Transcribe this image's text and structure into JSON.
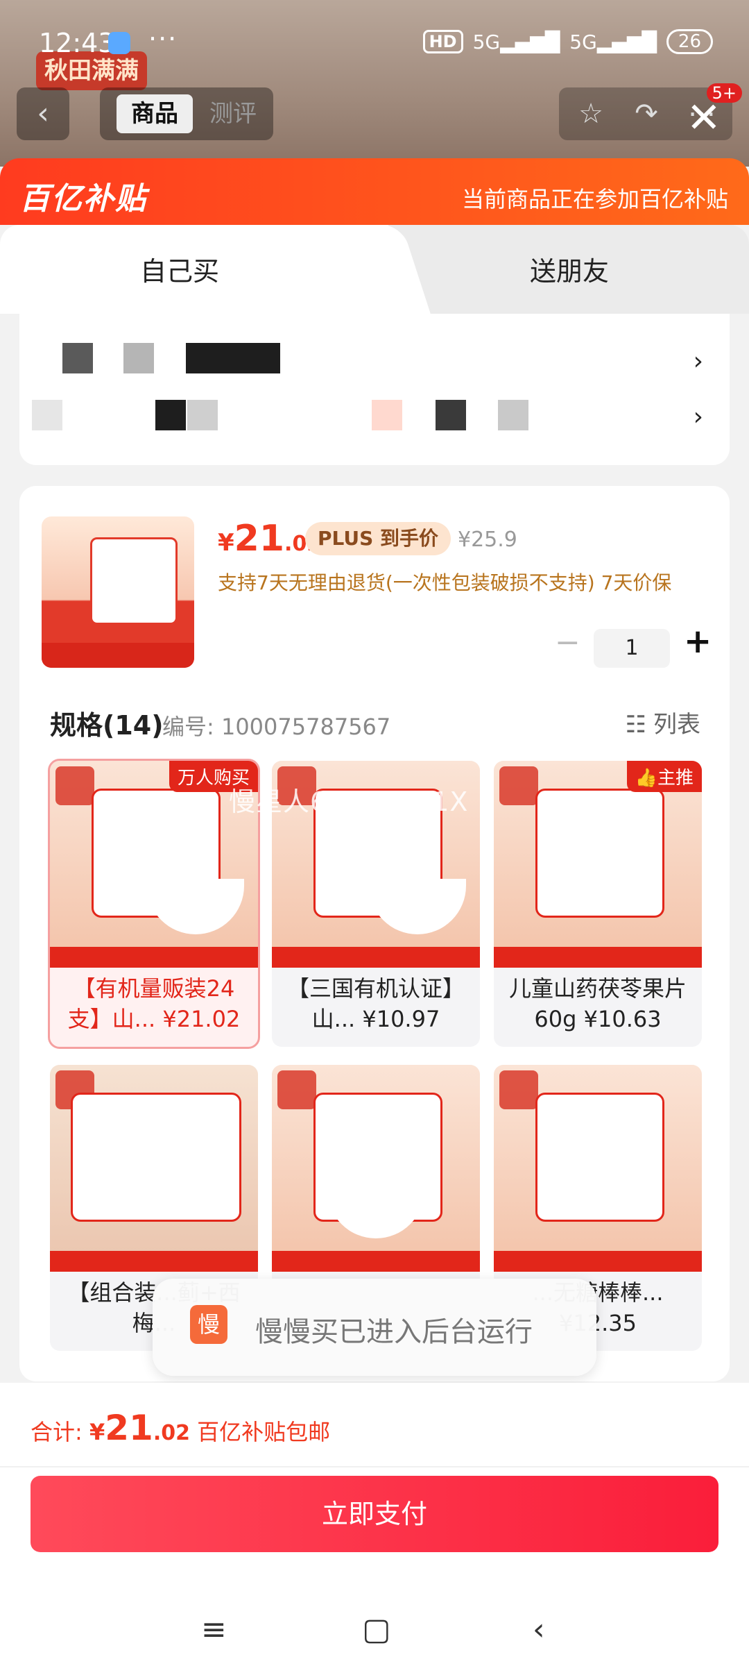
{
  "status_bar": {
    "time": "12:43",
    "dots": "···",
    "hd": "HD",
    "net1": "5G",
    "net2": "5G",
    "battery": "26"
  },
  "bg_nav": {
    "badge_text": "秋田满满",
    "tab_product": "商品",
    "tab_review": "测评",
    "notif_count": "5+"
  },
  "header": {
    "brand": "百亿补贴",
    "note": "当前商品正在参加百亿补贴"
  },
  "tabs": {
    "self": "自己买",
    "friend": "送朋友"
  },
  "address": {
    "arrow": "›"
  },
  "product": {
    "price_symbol": "¥",
    "price_int": "21",
    "price_dec": ".02",
    "plus_tag": "PLUS 到手价",
    "orig_price": "¥25.9",
    "service_note": "支持7天无理由退货(一次性包装破损不支持) 7天价保",
    "qty": "1",
    "minus": "−",
    "plus": "+"
  },
  "spec": {
    "title": "规格(14)",
    "code": "编号: 100075787567",
    "view": "列表"
  },
  "skus": [
    {
      "name": "【有机量贩装24支】山... ¥21.02",
      "tag": "万人购买",
      "selected": true
    },
    {
      "name": "【三国有机认证】山... ¥10.97",
      "tag": ""
    },
    {
      "name": "儿童山药茯苓果片60g ¥10.63",
      "tag": "主推"
    },
    {
      "name": "【组合装...蓟+西梅...",
      "tag": ""
    },
    {
      "name": "",
      "tag": ""
    },
    {
      "name": "...无糖棒棒... ¥12.35",
      "tag": ""
    }
  ],
  "watermark": "慢星人69738191X",
  "toast": {
    "icon": "慢",
    "text": "慢慢买已进入后台运行"
  },
  "footer": {
    "total_label": "合计: ",
    "total_symbol": "¥",
    "total_int": "21",
    "total_dec": ".02",
    "total_note": " 百亿补贴包邮",
    "pay_button": "立即支付"
  },
  "sysnav": {
    "menu": "≡",
    "home": "▢",
    "back": "‹"
  }
}
